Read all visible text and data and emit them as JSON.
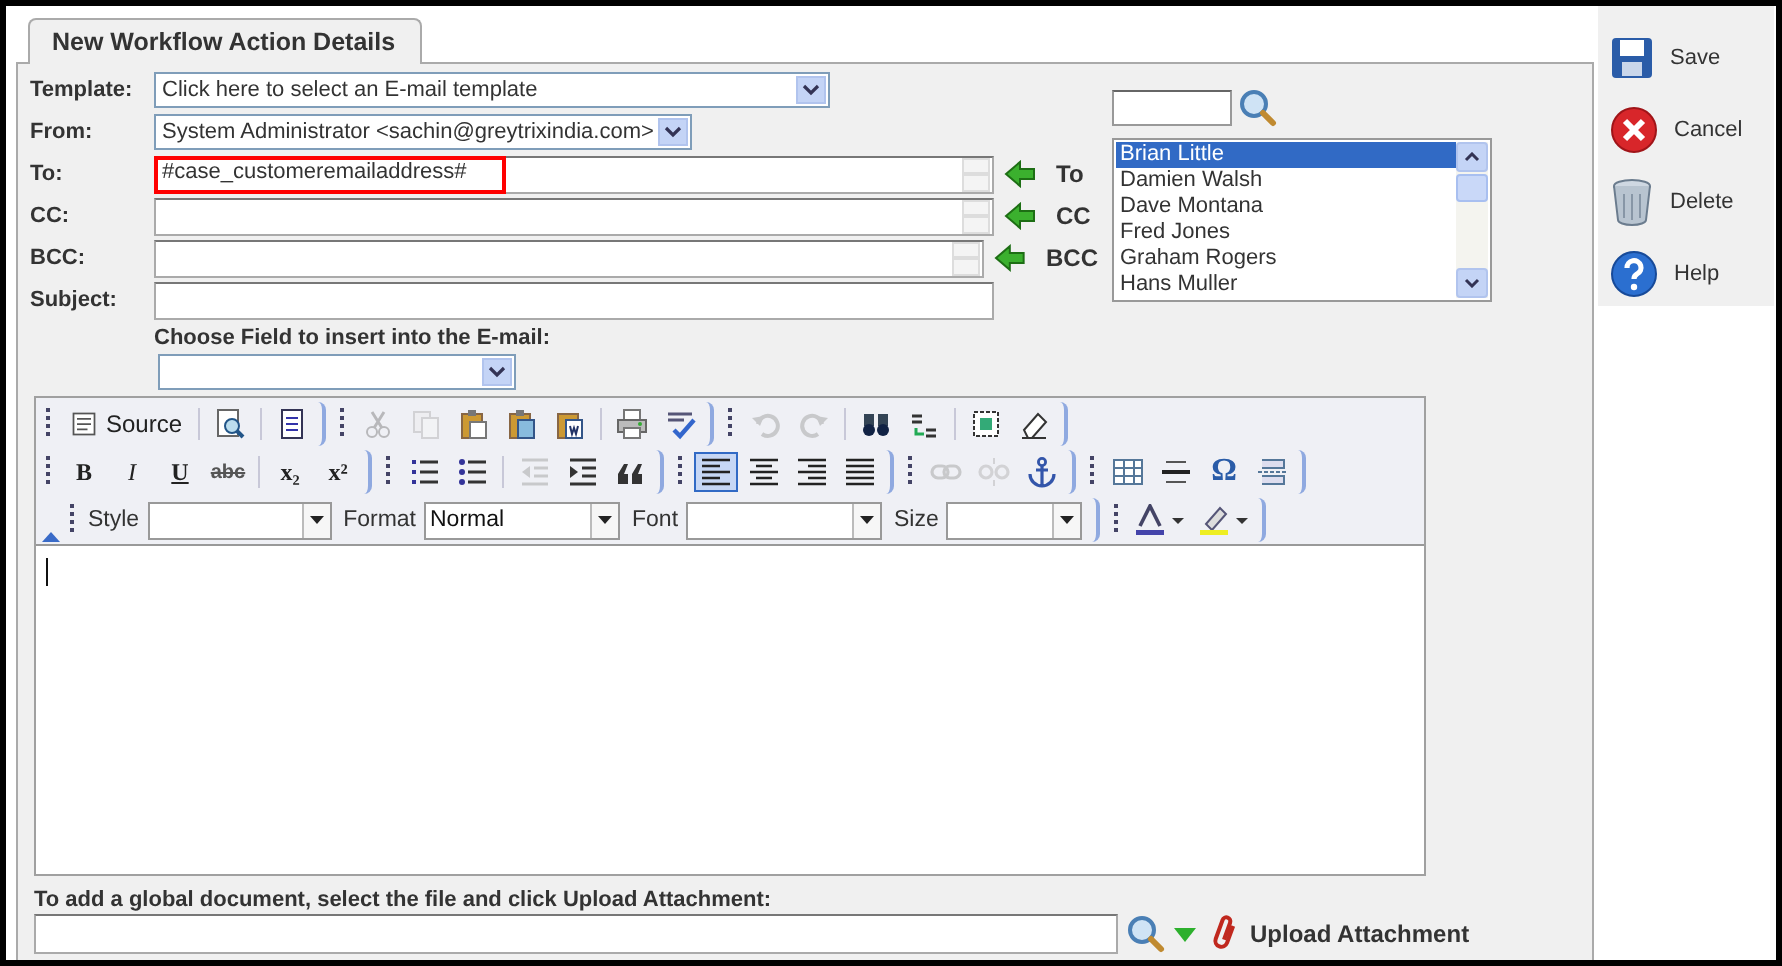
{
  "tab": {
    "label": "New Workflow Action Details",
    "selected": true
  },
  "template": {
    "label": "Template:",
    "value": "Click here to select an E-mail template"
  },
  "from": {
    "label": "From:",
    "value": "System Administrator <sachin@greytrixindia.com>"
  },
  "recipients": [
    {
      "label": "To:",
      "value": "#case_customeremailaddress#",
      "highlighted": true,
      "target": "To"
    },
    {
      "label": "CC:",
      "highlighted": false,
      "target": "CC"
    },
    {
      "label": "BCC:",
      "highlighted": false,
      "target": "BCC"
    }
  ],
  "subject": {
    "label": "Subject:"
  },
  "contacts": [
    {
      "name": "Brian Little",
      "selected": true
    },
    {
      "name": "Damien Walsh",
      "selected": false
    },
    {
      "name": "Dave Montana",
      "selected": false
    },
    {
      "name": "Fred Jones",
      "selected": false
    },
    {
      "name": "Graham Rogers",
      "selected": false
    },
    {
      "name": "Hans Muller",
      "selected": false
    }
  ],
  "choose_field": {
    "label": "Choose Field to insert into the E-mail:"
  },
  "editor": {
    "source_label": "Source",
    "text_buttons": [
      {
        "label": "B",
        "kind": "bold"
      },
      {
        "label": "I",
        "kind": "italic"
      },
      {
        "label": "U",
        "kind": "underline"
      },
      {
        "label": "abc",
        "kind": "strike"
      },
      {
        "label": "x₂",
        "kind": "subscript"
      },
      {
        "label": "x²",
        "kind": "superscript"
      }
    ],
    "alignment": [
      {
        "selected": true
      },
      {
        "selected": false
      },
      {
        "selected": false
      },
      {
        "selected": false
      }
    ],
    "special_char": "Ω",
    "combos": [
      {
        "label": "Style"
      },
      {
        "label": "Format",
        "value": "Normal"
      },
      {
        "label": "Font"
      },
      {
        "label": "Size"
      }
    ]
  },
  "attachment": {
    "label": "To add a global document, select the file and click Upload Attachment:",
    "button": "Upload Attachment"
  },
  "actions": [
    {
      "label": "Save",
      "kind": "save"
    },
    {
      "label": "Cancel",
      "kind": "cancel"
    },
    {
      "label": "Delete",
      "kind": "delete"
    },
    {
      "label": "Help",
      "kind": "help"
    }
  ]
}
